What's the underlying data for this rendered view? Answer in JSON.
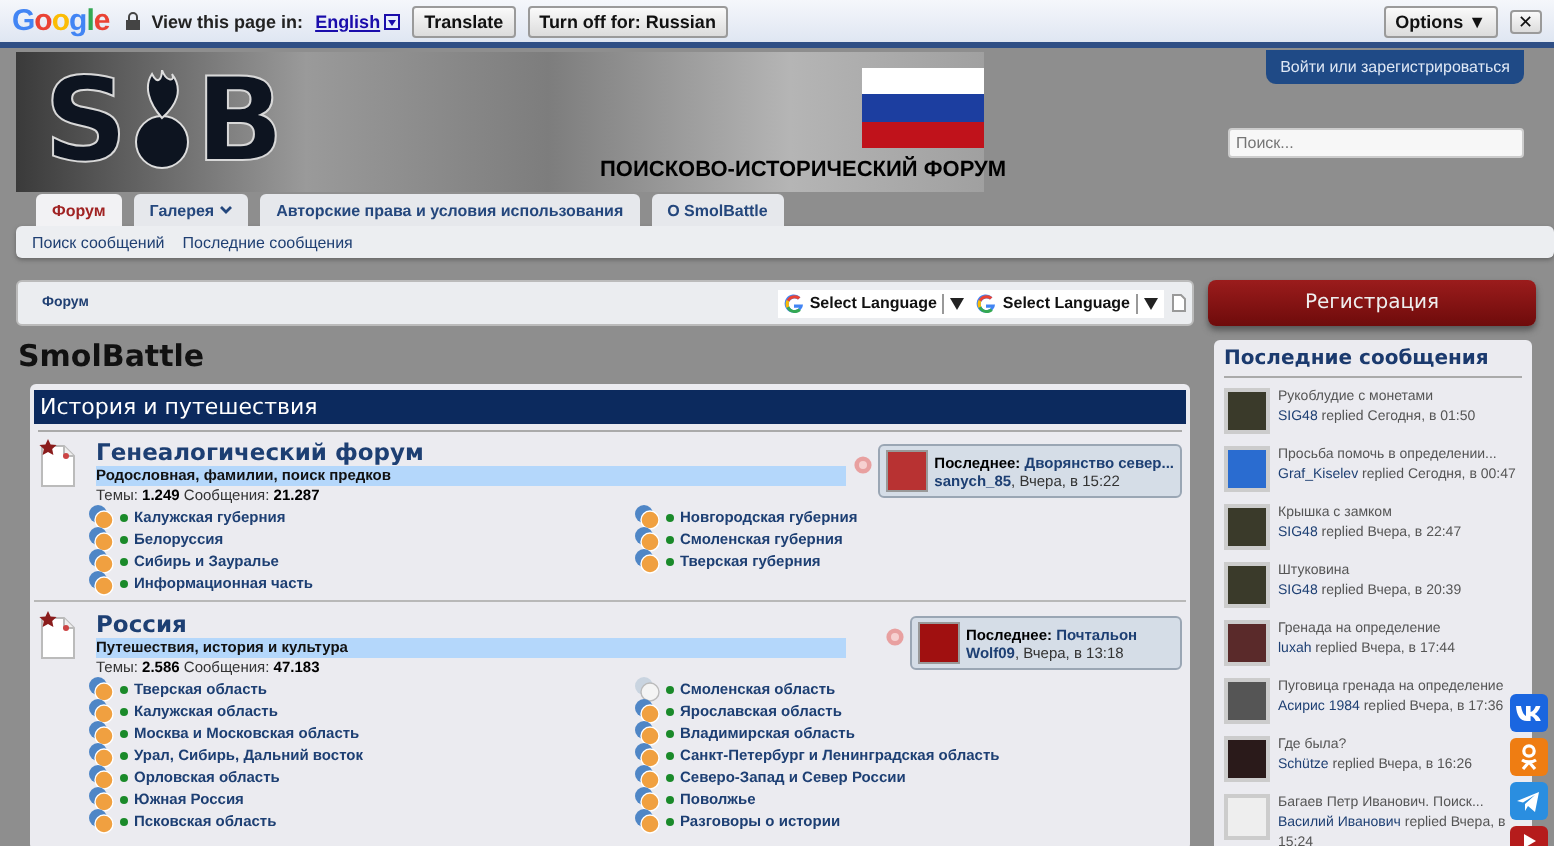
{
  "translate_bar": {
    "brand": "Google",
    "label": "View this page in:",
    "language": "English",
    "buttons": [
      "Translate",
      "Turn off for: Russian"
    ],
    "options": "Options ▼",
    "close": "✕"
  },
  "header": {
    "logo_letters": [
      "S",
      "B"
    ],
    "site_title": "ПОИСКОВО-ИСТОРИЧЕСКИЙ ФОРУМ",
    "login": "Войти или зарегистрироваться",
    "search": {
      "placeholder": "Поиск..."
    }
  },
  "tabs": [
    {
      "label": "Форум",
      "selected": true,
      "dropdown": false
    },
    {
      "label": "Галерея",
      "selected": false,
      "dropdown": true
    },
    {
      "label": "Авторские права и условия использования",
      "selected": false,
      "dropdown": false
    },
    {
      "label": "О SmolBattle",
      "selected": false,
      "dropdown": false
    }
  ],
  "subnav": [
    "Поиск сообщений",
    "Последние сообщения"
  ],
  "breadcrumb": [
    "Форум"
  ],
  "language_selectors": [
    {
      "label": "Select Language"
    },
    {
      "label": "Select Language"
    }
  ],
  "page_title": "SmolBattle",
  "category": {
    "title": "История и путешествия",
    "forums": [
      {
        "title": "Генеалогический форум",
        "description": "Родословная, фамилии, поиск предков",
        "stats": "Темы: **1.249** Сообщения: **21.287**",
        "last_post": {
          "label": "Последнее:",
          "thread": "Дворянство север...",
          "user": "sanych_85",
          "date": ", Вчера, в 15:22"
        },
        "subforums": [
          {
            "title": "Калужская губерния",
            "unread": true
          },
          {
            "title": "Новгородская губерния",
            "unread": true
          },
          {
            "title": "Белоруссия",
            "unread": true
          },
          {
            "title": "Смоленская губерния",
            "unread": true
          },
          {
            "title": "Сибирь и Зауралье",
            "unread": true
          },
          {
            "title": "Тверская губерния",
            "unread": true
          },
          {
            "title": "Информационная часть",
            "unread": true
          }
        ]
      },
      {
        "title": "Россия",
        "description": "Путешествия, история и культура",
        "stats": "Темы: **2.586** Сообщения: **47.183**",
        "last_post": {
          "label": "Последнее:",
          "thread": "Почтальон",
          "user": "Wolf09",
          "date": ", Вчера, в 13:18"
        },
        "subforums": [
          {
            "title": "Тверская область",
            "unread": true
          },
          {
            "title": "Смоленская область",
            "unread": false
          },
          {
            "title": "Калужская область",
            "unread": true
          },
          {
            "title": "Ярославская область",
            "unread": true
          },
          {
            "title": "Москва и Московская область",
            "unread": true
          },
          {
            "title": "Владимирская область",
            "unread": true
          },
          {
            "title": "Урал, Сибирь, Дальний восток",
            "unread": true
          },
          {
            "title": "Санкт-Петербург и Ленинградская область",
            "unread": true
          },
          {
            "title": "Орловская область",
            "unread": true
          },
          {
            "title": "Северо-Запад и Север России",
            "unread": true
          },
          {
            "title": "Южная Россия",
            "unread": true
          },
          {
            "title": "Поволжье",
            "unread": true
          },
          {
            "title": "Псковская область",
            "unread": true
          },
          {
            "title": "Разговоры о истории",
            "unread": true
          }
        ]
      }
    ]
  },
  "sidebar": {
    "register": "Регистрация",
    "title": "Последние сообщения",
    "posts": [
      {
        "title": "Рукоблудие с монетами",
        "user": "SIG48",
        "action": "replied",
        "time": "Сегодня, в 01:50"
      },
      {
        "title": "Просьба помочь в определении...",
        "user": "Graf_Kiselev",
        "action": "replied",
        "time": "Сегодня, в 00:47"
      },
      {
        "title": "Крышка с замком",
        "user": "SIG48",
        "action": "replied",
        "time": "Вчера, в 22:47"
      },
      {
        "title": "Штуковина",
        "user": "SIG48",
        "action": "replied",
        "time": "Вчера, в 20:39"
      },
      {
        "title": "Гренада на определение",
        "user": "luxah",
        "action": "replied",
        "time": "Вчера, в 17:44"
      },
      {
        "title": "Пуговица гренада на определение",
        "user": "Асирис 1984",
        "action": "replied",
        "time": "Вчера, в 17:36"
      },
      {
        "title": "Где была?",
        "user": "Schütze",
        "action": "replied",
        "time": "Вчера, в 16:26"
      },
      {
        "title": "Багаев Петр Иванович. Поиск...",
        "user": "Василий Иванович",
        "action": "replied",
        "time": "Вчера, в 15:24"
      }
    ]
  }
}
